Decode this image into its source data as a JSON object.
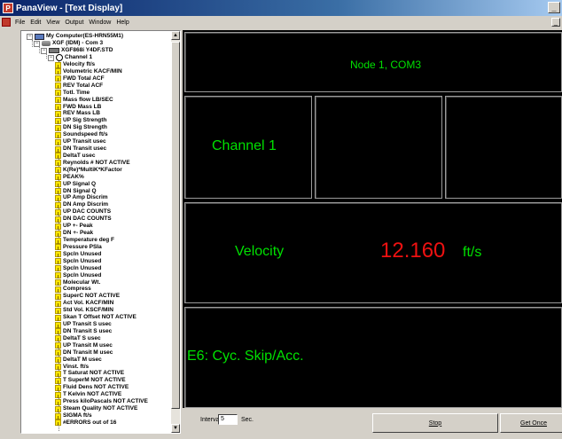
{
  "window": {
    "title": "PanaView - [Text Display]",
    "minimize": "_",
    "mdi_minimize": "_"
  },
  "menu": [
    "File",
    "Edit",
    "View",
    "Output",
    "Window",
    "Help"
  ],
  "tree": {
    "root": "My Computer(ES-HRN55M1)",
    "meter": "XGF (IDM) - Com 3",
    "device": "XGF868i Y4DF.STD",
    "channel": "Channel 1",
    "params": [
      "Velocity  ft/s",
      "Volumetric  KACF/MIN",
      "FWD Total  ACF",
      "REV Total  ACF",
      "Totl. Time",
      "Mass flow  LB/SEC",
      "FWD Mass   LB",
      "REV Mass   LB",
      "UP Sig Strength",
      "DN Sig Strength",
      "Soundspeed  ft/s",
      "UP Transit  usec",
      "DN Transit  usec",
      "DeltaT  usec",
      "Reynolds #  NOT ACTIVE",
      "K(Re)*MultiK*KFactor",
      "PEAK%",
      "UP Signal Q",
      "DN Signal Q",
      "UP Amp Discrim",
      "DN Amp Discrim",
      "UP DAC COUNTS",
      "DN DAC COUNTS",
      "UP +- Peak",
      "DN +- Peak",
      "Temperature  deg F",
      "Pressure  PSIa",
      "Spcln   Unused",
      "Spcln   Unused",
      "Spcln   Unused",
      "Spcln   Unused",
      "Molecular Wt.",
      "Compress",
      "SuperC  NOT ACTIVE",
      "Act Vol.  KACF/MIN",
      "Std Vol.  KSCF/MIN",
      "Skan T Offset  NOT ACTIVE",
      "UP Transit S  usec",
      "DN Transit S  usec",
      "DeltaT S   usec",
      "UP Transit M  usec",
      "DN Transit M  usec",
      "DeltaT M   usec",
      "Vinst.  ft/s",
      "T Saturat  NOT ACTIVE",
      "T SuperM  NOT ACTIVE",
      "Fluid Dens  NOT ACTIVE",
      "T Kelvin        NOT ACTIVE",
      "Press kiloPascals  NOT ACTIVE",
      "Steam Quality  NOT ACTIVE",
      "SIGMA ft/s",
      "#ERRORS out of 16"
    ]
  },
  "display": {
    "node": "Node 1, COM3",
    "channel": "Channel 1",
    "param_name": "Velocity",
    "value": "12.160",
    "unit": "ft/s",
    "error": "E6: Cyc. Skip/Acc.",
    "colors": {
      "green": "#00e000",
      "red": "#ee1111",
      "background": "#000000"
    }
  },
  "status": {
    "interval_label": "Interval",
    "interval_value": "5",
    "sec_label": "Sec.",
    "stop_label": "Stop",
    "get_once_label": "Get Once"
  }
}
